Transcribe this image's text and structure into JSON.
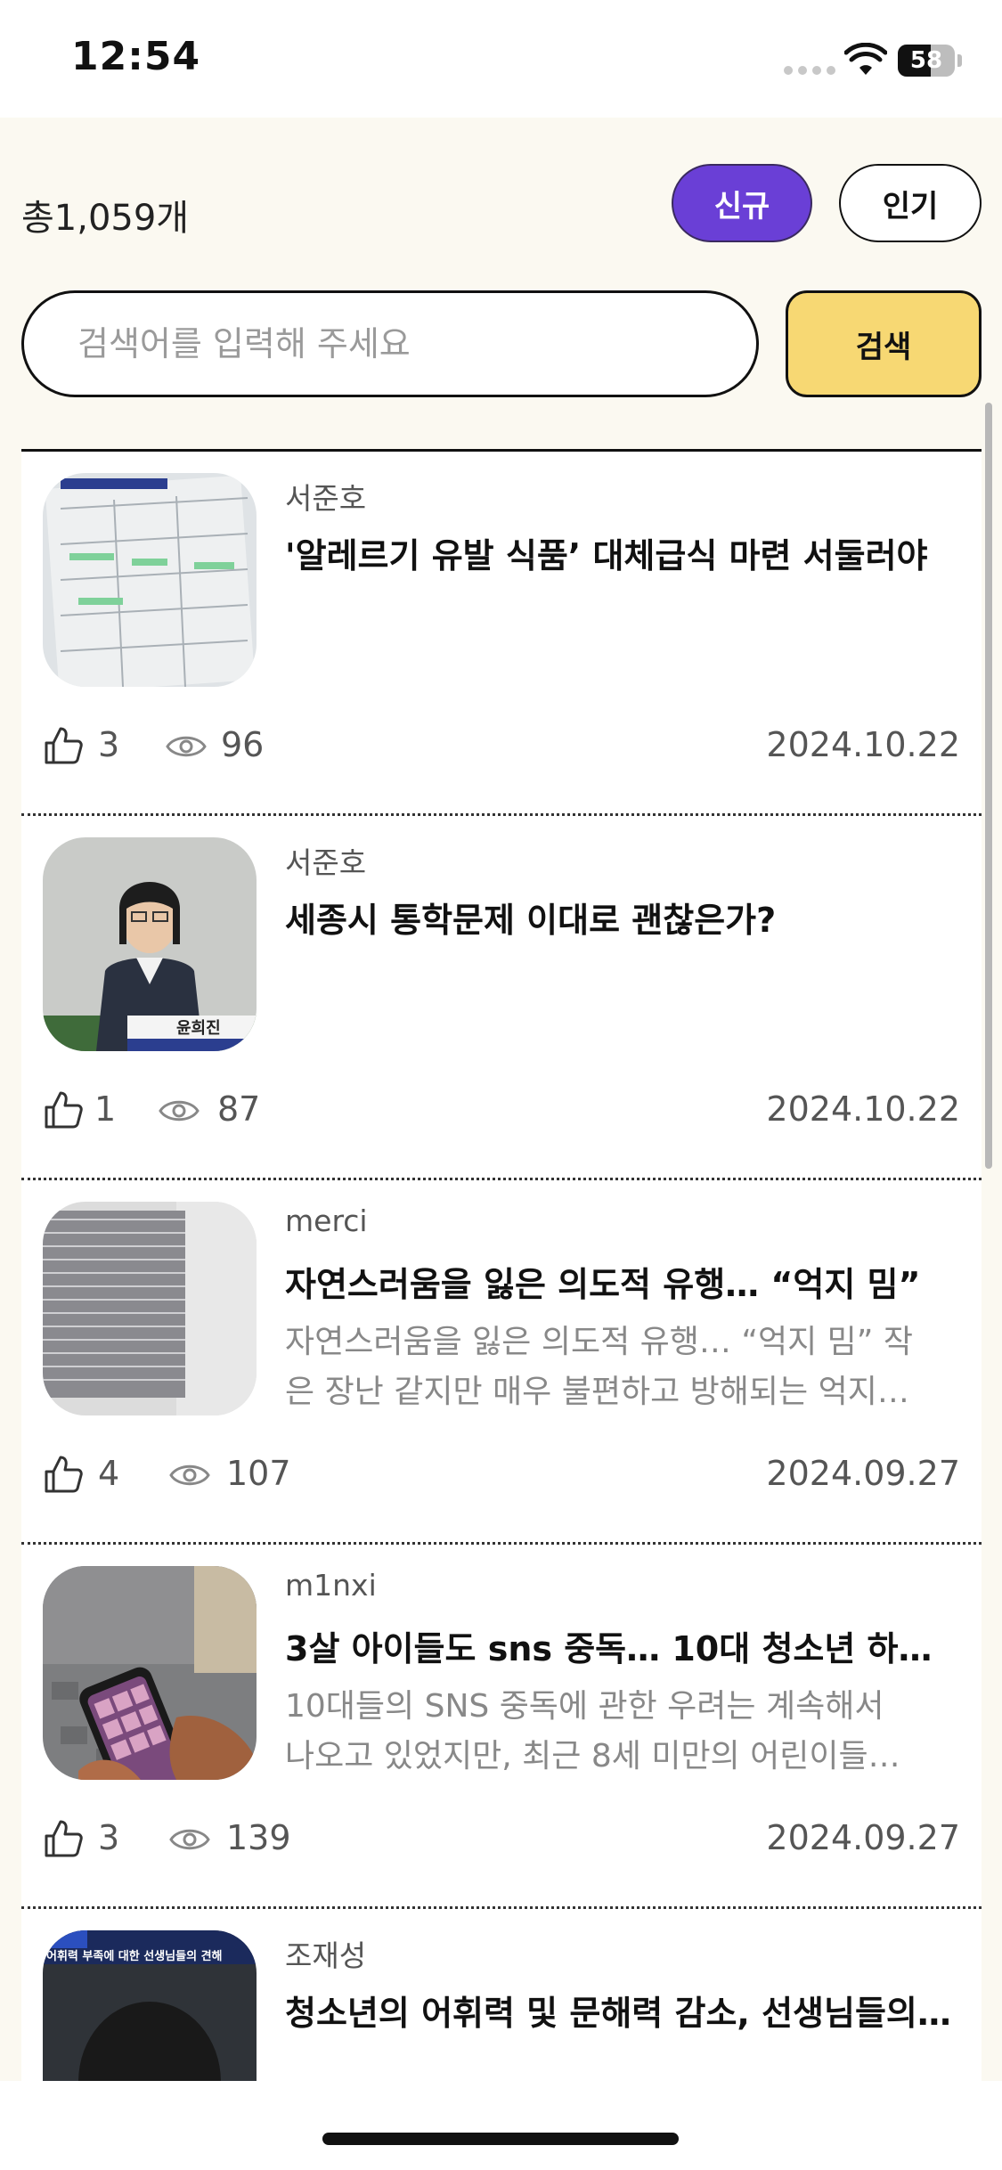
{
  "status_bar": {
    "time": "12:54",
    "battery_percent": "58",
    "battery_level": 0.58
  },
  "header": {
    "total_count": "총1,059개",
    "sort_new": "신규",
    "sort_popular": "인기"
  },
  "search": {
    "placeholder": "검색어를 입력해 주세요",
    "value": "",
    "button_label": "검색"
  },
  "articles": [
    {
      "author": "서준호",
      "title": "'알레르기 유발 식품’ 대체급식 마련 서둘러야",
      "summary": [
        "",
        ""
      ],
      "likes": "3",
      "views": "96",
      "date": "2024.10.22",
      "thumb_text": "",
      "thumb_caption": ""
    },
    {
      "author": "서준호",
      "title": "세종시 통학문제 이대로 괜찮은가?",
      "summary": [
        "",
        ""
      ],
      "likes": "1",
      "views": "87",
      "date": "2024.10.22",
      "thumb_text": "",
      "thumb_caption": "윤희진"
    },
    {
      "author": "merci",
      "title": "자연스러움을 잃은 의도적 유행… “억지 밈”",
      "summary": [
        "자연스러움을 잃은 의도적 유행… “억지 밈” 작",
        "은 장난 같지만 매우 불편하고 방해되는 억지…"
      ],
      "likes": "4",
      "views": "107",
      "date": "2024.09.27",
      "thumb_text": "",
      "thumb_caption": ""
    },
    {
      "author": "m1nxi",
      "title": "3살 아이들도 sns 중독… 10대 청소년 하루 …",
      "summary": [
        "10대들의 SNS 중독에 관한 우려는 계속해서",
        "나오고 있었지만, 최근 8세 미만의 어린이들…"
      ],
      "likes": "3",
      "views": "139",
      "date": "2024.09.27",
      "thumb_text": "",
      "thumb_caption": ""
    },
    {
      "author": "조재성",
      "title": "청소년의 어휘력 및 문해력 감소, 선생님들의…",
      "summary": [
        "",
        ""
      ],
      "likes": "",
      "views": "",
      "date": "",
      "thumb_text": "어휘력 부족에 대한 선생님들의 견해",
      "thumb_caption": ""
    }
  ],
  "colors": {
    "accent_purple": "#6a3fd6",
    "search_yellow": "#f7d873",
    "background": "#fbf9f1"
  },
  "icons": {
    "like": "thumbs-up-icon",
    "views": "eye-icon",
    "wifi": "wifi-icon",
    "battery": "battery-icon"
  }
}
